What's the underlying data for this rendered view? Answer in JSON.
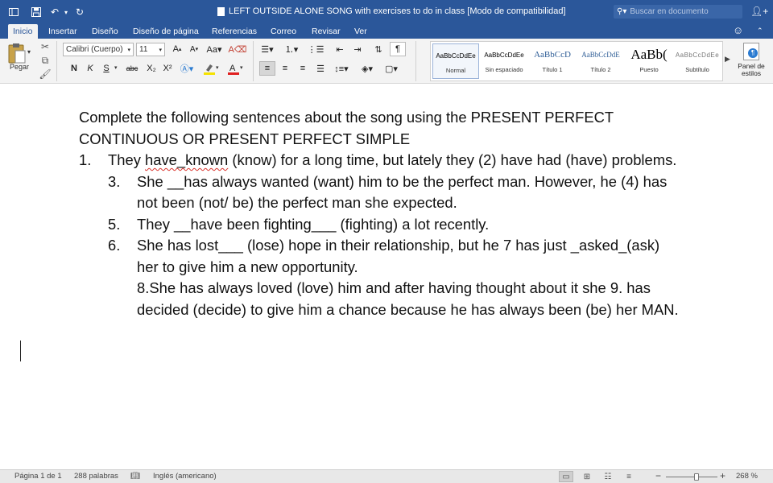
{
  "titlebar": {
    "document_title": "LEFT OUTSIDE ALONE SONG with exercises to do in class [Modo de compatibilidad]",
    "search_placeholder": "Buscar en documento"
  },
  "tabs": [
    "Inicio",
    "Insertar",
    "Diseño",
    "Diseño de página",
    "Referencias",
    "Correo",
    "Revisar",
    "Ver"
  ],
  "ribbon": {
    "paste_label": "Pegar",
    "font_name": "Calibri (Cuerpo)",
    "font_size": "11",
    "bold": "N",
    "italic": "K",
    "underline": "S",
    "strikethrough": "abc",
    "subscript": "X₂",
    "superscript": "X²",
    "styles": [
      {
        "sample": "AaBbCcDdEe",
        "name": "Normal"
      },
      {
        "sample": "AaBbCcDdEe",
        "name": "Sin espaciado"
      },
      {
        "sample": "AaBbCcD",
        "name": "Título 1"
      },
      {
        "sample": "AaBbCcDdE",
        "name": "Título 2"
      },
      {
        "sample": "AaBb(",
        "name": "Puesto"
      },
      {
        "sample": "AaBbCcDdEe",
        "name": "Subtítulo"
      }
    ],
    "styles_pane_label_1": "Panel de",
    "styles_pane_label_2": "estilos"
  },
  "document": {
    "heading_line_1": "Complete the following sentences about the song using the PRESENT PERFECT",
    "heading_line_2": "CONTINUOUS OR PRESENT PERFECT SIMPLE",
    "item1_num": "1.",
    "item1_pre": "They ",
    "item1_squiggle": "have_known",
    "item1_post": " (know) for a long time, but lately they (2) have had (have) problems.",
    "item3_num": "3.",
    "item3_line1": "She __has always wanted (want) him to be the perfect man. However, he (4) has",
    "item3_line2": "not been (not/ be) the perfect man she expected.",
    "item5_num": "5.",
    "item5_line1": "They __have been fighting___ (fighting) a lot recently.",
    "item6_num": "6.",
    "item6_line1": "She has lost___ (lose) hope in their relationship, but he 7 has just _asked_(ask)",
    "item6_line2": "her to give him a new opportunity.",
    "item8_line1": "8.She has always loved (love) him and after having thought about it she 9. has",
    "item8_line2": "decided (decide) to give him a chance because he has always been (be) her MAN."
  },
  "statusbar": {
    "page": "Página 1 de 1",
    "words": "288 palabras",
    "language": "Inglés (americano)",
    "zoom_minus": "−",
    "zoom_plus": "+",
    "zoom": "268 %"
  },
  "colors": {
    "titlebar_bg": "#2b579a",
    "ribbon_bg": "#f3f3f3",
    "statusbar_bg": "#e8e8e8",
    "spellcheck_underline": "#d9312a"
  }
}
